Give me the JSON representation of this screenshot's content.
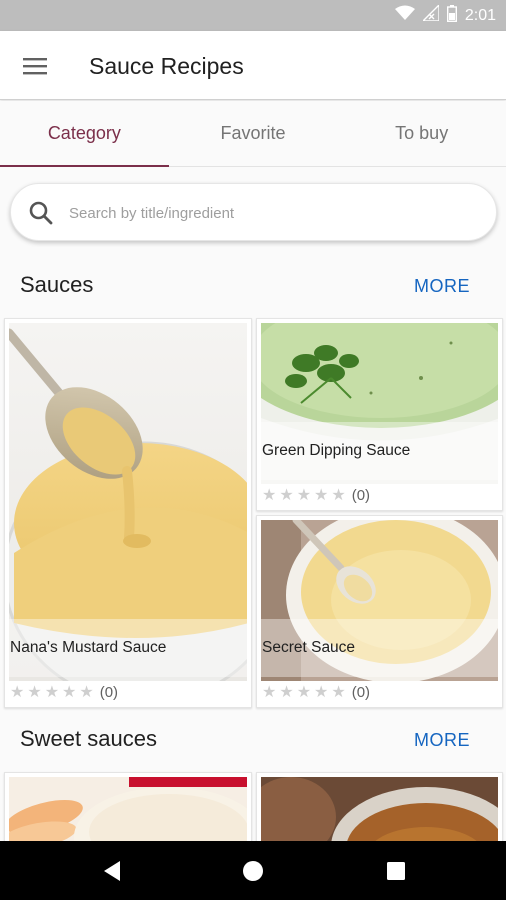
{
  "status_bar": {
    "time": "2:01",
    "icons": [
      "wifi-icon",
      "signal-icon",
      "battery-icon"
    ]
  },
  "app_bar": {
    "title": "Sauce Recipes",
    "menu_icon": "hamburger-menu-icon"
  },
  "tabs": [
    {
      "label": "Category",
      "active": true
    },
    {
      "label": "Favorite",
      "active": false
    },
    {
      "label": "To buy",
      "active": false
    }
  ],
  "search": {
    "placeholder": "Search by title/ingredient",
    "value": ""
  },
  "sections": [
    {
      "title": "Sauces",
      "more_label": "MORE",
      "cards": [
        {
          "title": "Nana's Mustard Sauce",
          "rating_count": "(0)",
          "stars": 0
        },
        {
          "title": "Green Dipping Sauce",
          "rating_count": "(0)",
          "stars": 0
        },
        {
          "title": "Secret Sauce",
          "rating_count": "(0)",
          "stars": 0
        }
      ]
    },
    {
      "title": "Sweet sauces",
      "more_label": "MORE"
    }
  ],
  "colors": {
    "accent": "#7b2f4a",
    "link": "#1565c0",
    "status_bar": "#bdbdbd"
  },
  "nav_bar": {
    "icons": [
      "back-icon",
      "home-icon",
      "recents-icon"
    ]
  }
}
